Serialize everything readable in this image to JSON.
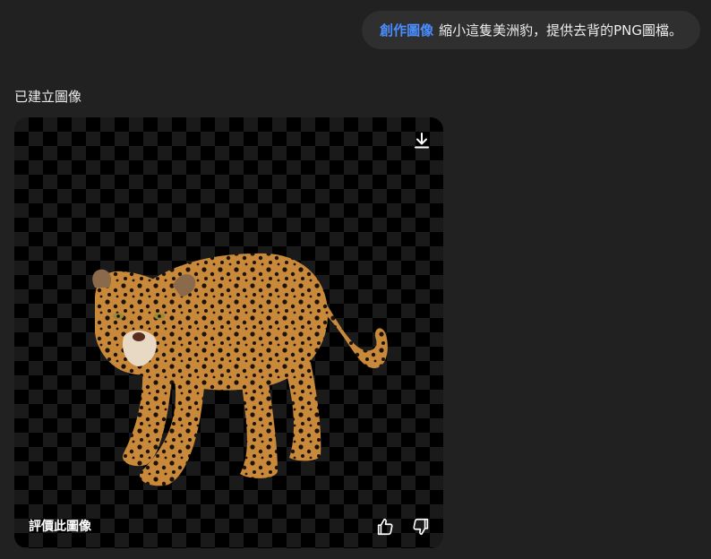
{
  "user_message": {
    "tool_label": "創作圖像",
    "text": "縮小這隻美洲豹，提供去背的PNG圖檔。"
  },
  "response": {
    "status": "已建立圖像",
    "image": {
      "subject": "jaguar",
      "background": "transparent-checkerboard",
      "download_icon": "download-icon"
    },
    "feedback": {
      "prompt": "評價此圖像",
      "like_icon": "thumbs-up-icon",
      "dislike_icon": "thumbs-down-icon"
    }
  },
  "colors": {
    "page_bg": "#212121",
    "bubble_bg": "#2f2f2f",
    "tool_accent": "#4a8dff",
    "text": "#ececec"
  }
}
